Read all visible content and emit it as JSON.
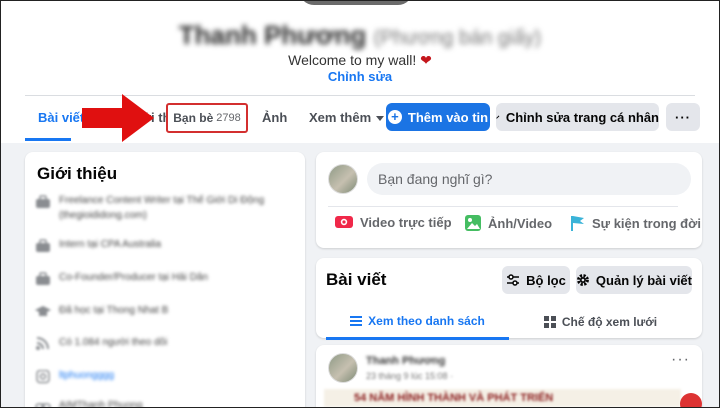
{
  "profile": {
    "name": "Thanh Phương",
    "nickname": "(Phương bán giấy)",
    "bio": "Welcome to my wall!",
    "bio_emoji": "❤",
    "edit_bio_label": "Chỉnh sửa"
  },
  "tabs": {
    "posts": "Bài viết",
    "about": "Giới thiệu",
    "friends": "Bạn bè",
    "friends_count": "2798",
    "photos": "Ảnh",
    "more": "Xem thêm"
  },
  "actions": {
    "add_story": "Thêm vào tin",
    "edit_profile": "Chỉnh sửa trang cá nhân",
    "more_dots": "···"
  },
  "intro": {
    "title": "Giới thiệu",
    "items": [
      {
        "icon": "briefcase-icon",
        "text": "Freelance Content Writer tại Thế Giới Di Động (thegioididong.com)"
      },
      {
        "icon": "briefcase-icon",
        "text": "Intern tại CPA Australia"
      },
      {
        "icon": "briefcase-icon",
        "text": "Co-Founder/Producer tại Hải Dân"
      },
      {
        "icon": "graduation-cap-icon",
        "text": "Đã học tại Thong Nhat B"
      },
      {
        "icon": "rss-icon",
        "text": "Có 1.084 người theo dõi"
      },
      {
        "icon": "instagram-icon",
        "text": "ltphuongggg"
      },
      {
        "icon": "link-icon",
        "text": "AIMThanh Phuong"
      }
    ]
  },
  "composer": {
    "placeholder": "Bạn đang nghĩ gì?",
    "live_video": "Video trực tiếp",
    "photo_video": "Ảnh/Video",
    "life_event": "Sự kiện trong đời"
  },
  "posts_section": {
    "title": "Bài viết",
    "filter_label": "Bộ lọc",
    "manage_label": "Quản lý bài viết",
    "list_view": "Xem theo danh sách",
    "grid_view": "Chế độ xem lưới"
  },
  "post": {
    "author": "Thanh Phương",
    "date": "23 tháng 9 lúc 15:08 ·",
    "banner": "54 NĂM HÌNH THÀNH VÀ PHÁT TRIỂN",
    "dots": "···"
  },
  "colors": {
    "accent": "#1877f2",
    "primary_button": "#1b74e4",
    "annotation_red": "#d32f2f"
  }
}
